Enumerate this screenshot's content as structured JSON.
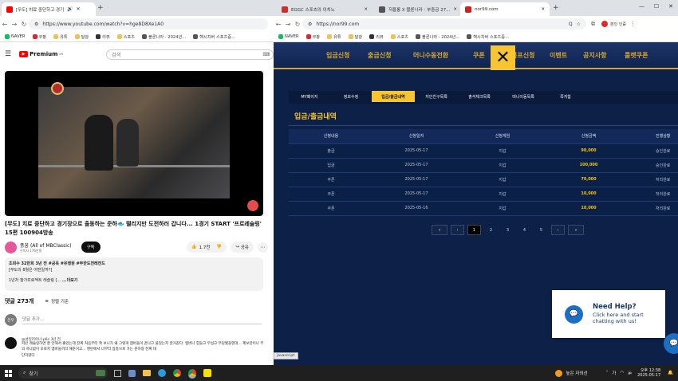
{
  "left": {
    "tabs": [
      {
        "label": "[무도] 치료 중단하고 경기"
      }
    ],
    "url": "https://www.youtube.com/watch?v=hge8D8Xe1A0",
    "bookmarks": [
      "NAVER",
      "쿠팡",
      "유튜",
      "달광",
      "리뷰",
      "스포츠",
      "블론나라 - 2024년...",
      "헥시치버 스포츠중..."
    ],
    "logo_label": "Premium",
    "logo_sup": "KR",
    "search_placeholder": "검색",
    "video_title": "[무도] 치료 중단하고 경기장으로 출동하는 준하🐟 떨리지만 도전하러 갑니다... 1경기 START '프로레슬링' 15편 100904방송",
    "channel": "풍꿈 (All of MBClassic)",
    "subs": "구독자 176만명",
    "subscribe": "구독",
    "likes": "1.7천",
    "share": "공유",
    "desc_line1": "조회수 32만회  3년 전  #공옥 #유행원 #무한도전레전드",
    "desc_line2": "[무도의 8월은 어떤일까?]",
    "desc_line3": "1년차 참가프로젝트 레슬링 [...",
    "desc_more": "...더보기",
    "comments_count": "댓글 273개",
    "sort_label": "정렬 기준",
    "avatar_initials": "전우",
    "comment_placeholder": "댓글 추가...",
    "commenter": "@성일리아나-p6s  3년 전",
    "comment_text": "저런 레슬링하면 잘 안해서 좋았는데 진짜 처음부터 쭉 보니가 왜 그렇게 멤버들이 끝나고 울었는지 알거같다. 멤버나 힘들고 무섭고 부담됐을텐데... 제보잔이나 무의 하나없이 모로지 멤버들끼리 해준거고... 멘탄에서 너부터 잠충으로 가는 준하형 진짜 대",
    "comment_more": "단하였다"
  },
  "right": {
    "tabs": [
      {
        "label": "EGGC 스포츠의 이치노"
      },
      {
        "label": "저울롱 X 블론나라 - 부중금 27..."
      },
      {
        "label": "nor99.com"
      }
    ],
    "url": "https://nor99.com",
    "bookmarks": [
      "NAVER",
      "쿠팡",
      "유튜",
      "달광",
      "리뷰",
      "스포츠",
      "블론나라 - 2024년...",
      "헥시치버 스포츠중..."
    ],
    "profile_label": "본인 인증",
    "zoom_label": "Q",
    "nav_items": [
      "입금신청",
      "출금신청",
      "머니수동전환",
      "쿠폰",
      "콤프신청",
      "이벤트",
      "공지사항",
      "룰렛쿠폰"
    ],
    "sub_tabs": [
      "MY페이지",
      "정보수정",
      "입금/출금내역",
      "지인친구목록",
      "출석체크목록",
      "머니이동목록",
      "쪽지함"
    ],
    "active_sub_tab": "입금/출금내역",
    "section_title": "입금/출금내역",
    "columns": [
      "신청내용",
      "신청일자",
      "신청게임",
      "신청금액",
      "진행상황"
    ],
    "rows": [
      [
        "출금",
        "2025-05-17",
        "지갑",
        "90,000",
        "승인완료"
      ],
      [
        "입금",
        "2025-05-17",
        "지갑",
        "100,000",
        "승인완료"
      ],
      [
        "쿠폰",
        "2025-05-17",
        "지갑",
        "70,000",
        "처리완료"
      ],
      [
        "쿠폰",
        "2025-05-17",
        "지갑",
        "10,000",
        "처리완료"
      ],
      [
        "쿠폰",
        "2025-05-16",
        "지갑",
        "10,000",
        "처리완료"
      ]
    ],
    "pagination": [
      "«",
      "‹",
      "1",
      "2",
      "3",
      "4",
      "5",
      "›",
      "»"
    ],
    "active_page": "1",
    "chat_title": "Need Help?",
    "chat_text": "Click here and start chatting with us!",
    "status_link": "javascript:"
  },
  "taskbar": {
    "search_label": "찾기",
    "weather": "높은 자외선",
    "time": "오후 12:38",
    "date": "2025-05-17"
  },
  "colors": {
    "site_bg": "#0d2148",
    "nav_gold": "#d8a52e",
    "amount_yellow": "#f0c419",
    "active_tab": "#f6c531",
    "youtube_red": "#ff0000"
  }
}
